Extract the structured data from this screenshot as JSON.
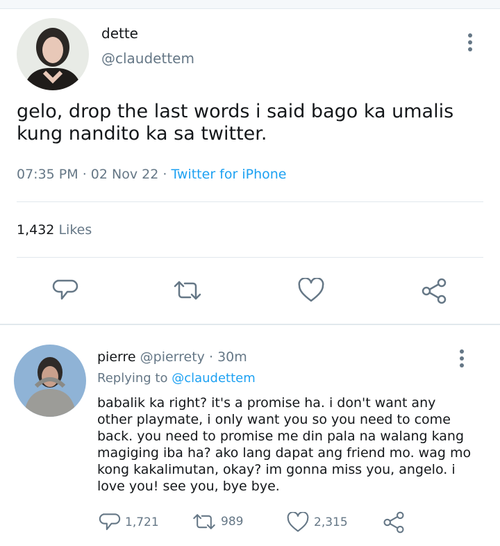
{
  "tweet": {
    "display_name": "dette",
    "handle": "@claudettem",
    "text": "gelo, drop the last words i said bago ka umalis kung nandito ka sa twitter.",
    "time": "07:35 PM",
    "date": "02 Nov 22",
    "source": "Twitter for iPhone",
    "likes_count": "1,432",
    "likes_label": "Likes",
    "more_icon": "more-vertical-icon"
  },
  "reply": {
    "display_name": "pierre",
    "handle": "@pierrety",
    "age": "30m",
    "replying_label": "Replying to",
    "replying_to": "@claudettem",
    "text": "babalik ka right? it's a promise ha. i don't want any other playmate, i only want you so you need to come back. you need to promise me din pala na walang kang magiging iba ha? ako lang dapat ang friend mo. wag mo kong kakalimutan, okay? im gonna miss you, angelo. i love you! see you, bye bye.",
    "reply_count": "1,721",
    "retweet_count": "989",
    "like_count": "2,315"
  },
  "colors": {
    "text": "#14171a",
    "secondary": "#657786",
    "accent": "#1da1f2",
    "divider": "#e1e8ed"
  }
}
